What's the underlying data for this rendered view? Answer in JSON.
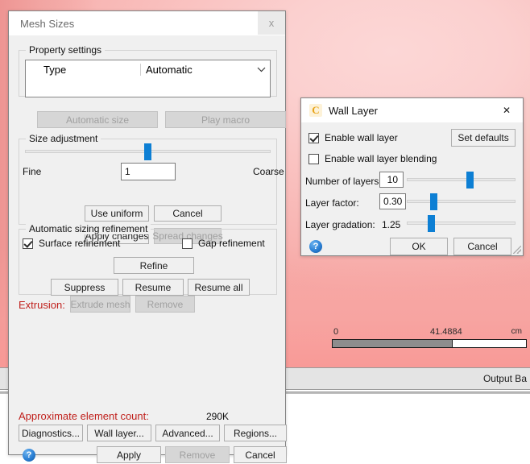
{
  "viewport": {
    "scalebar": {
      "min_label": "0",
      "mid_label": "41.4884",
      "unit_label": "cm",
      "fill_percent": 62
    }
  },
  "dock": {
    "panel_label": "Output Ba"
  },
  "mesh_dialog": {
    "title": "Mesh Sizes",
    "close_label": "x",
    "property_settings": {
      "group_title": "Property settings",
      "rows": [
        {
          "key": "Type",
          "value": "Automatic",
          "caret": "chevron-down-icon"
        }
      ]
    },
    "automatic_size_button": "Automatic size",
    "play_macro_button": "Play macro",
    "size_adjustment": {
      "group_title": "Size adjustment",
      "slider_percent": 50,
      "fine_label": "Fine",
      "coarse_label": "Coarse",
      "value": "1",
      "use_uniform_button": "Use uniform",
      "cancel_button": "Cancel",
      "apply_changes_button": "Apply changes",
      "spread_changes_button": "Spread changes"
    },
    "automatic_sizing_refinement": {
      "group_title": "Automatic sizing refinement",
      "surface_refinement_label": "Surface refinement",
      "surface_refinement_checked": true,
      "gap_refinement_label": "Gap refinement",
      "gap_refinement_checked": false,
      "refine_button": "Refine"
    },
    "suppress_button": "Suppress",
    "resume_button": "Resume",
    "resume_all_button": "Resume all",
    "extrusion_label": "Extrusion:",
    "extrude_mesh_button": "Extrude mesh",
    "extrusion_remove_button": "Remove",
    "element_count_label": "Approximate element count:",
    "element_count_value": "290K",
    "diagnostics_button": "Diagnostics...",
    "wall_layer_button": "Wall layer...",
    "advanced_button": "Advanced...",
    "regions_button": "Regions...",
    "help_button": "?",
    "apply_button": "Apply",
    "remove_button": "Remove",
    "cancel_button": "Cancel"
  },
  "wall_dialog": {
    "title": "Wall Layer",
    "app_icon": "c-logo-icon",
    "app_icon_glyph": "C",
    "close_label": "✕",
    "enable_wall_layer_label": "Enable wall layer",
    "enable_wall_layer_checked": true,
    "set_defaults_button": "Set defaults",
    "enable_blending_label": "Enable wall layer blending",
    "enable_blending_checked": false,
    "number_of_layers_label": "Number of layers:",
    "number_of_layers_value": "10",
    "number_of_layers_slider_percent": 59,
    "layer_factor_label": "Layer factor:",
    "layer_factor_value": "0.30",
    "layer_factor_slider_percent": 23,
    "layer_gradation_label": "Layer gradation:",
    "layer_gradation_value": "1.25",
    "layer_gradation_slider_percent": 21,
    "help_button": "?",
    "ok_button": "OK",
    "cancel_button": "Cancel"
  },
  "colors": {
    "accent_blue": "#0d7fd4",
    "alert_red": "#c0201c",
    "viewport_pink": "#f9bdbb",
    "dialog_face": "#f0f0f0"
  }
}
